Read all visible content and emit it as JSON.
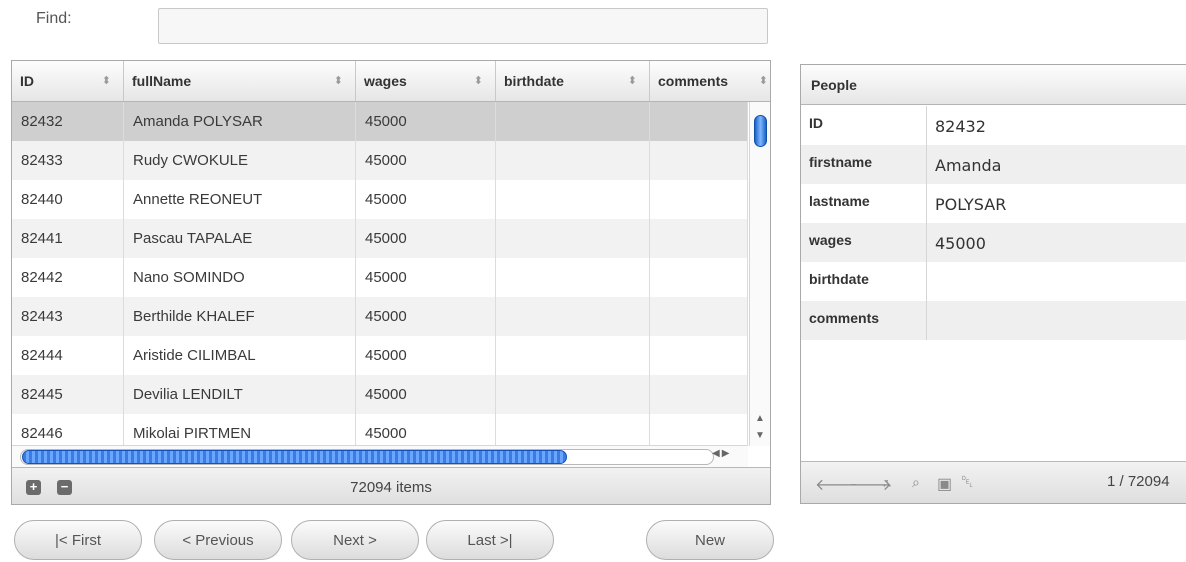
{
  "find": {
    "label": "Find:",
    "value": ""
  },
  "grid": {
    "columns": [
      "ID",
      "fullName",
      "wages",
      "birthdate",
      "comments"
    ],
    "rows": [
      [
        "82432",
        "Amanda POLYSAR",
        "45000",
        "",
        ""
      ],
      [
        "82433",
        "Rudy CWOKULE",
        "45000",
        "",
        ""
      ],
      [
        "82440",
        "Annette REONEUT",
        "45000",
        "",
        ""
      ],
      [
        "82441",
        "Pascau TAPALAE",
        "45000",
        "",
        ""
      ],
      [
        "82442",
        "Nano SOMINDO",
        "45000",
        "",
        ""
      ],
      [
        "82443",
        "Berthilde KHALEF",
        "45000",
        "",
        ""
      ],
      [
        "82444",
        "Aristide CILIMBAL",
        "45000",
        "",
        ""
      ],
      [
        "82445",
        "Devilia LENDILT",
        "45000",
        "",
        ""
      ],
      [
        "82446",
        "Mikolai PIRTMEN",
        "45000",
        "",
        ""
      ]
    ],
    "selected_row": 0,
    "sort_glyph": "⬍",
    "add_glyph": "+",
    "remove_glyph": "−",
    "item_count": "72094 items"
  },
  "nav": {
    "first": "|< First",
    "previous": "< Previous",
    "next": "Next >",
    "last": "Last >|",
    "new": "New"
  },
  "form": {
    "title": "People",
    "fields": [
      {
        "label": "ID",
        "value": "82432"
      },
      {
        "label": "firstname",
        "value": "Amanda"
      },
      {
        "label": "lastname",
        "value": "POLYSAR"
      },
      {
        "label": "wages",
        "value": "45000"
      },
      {
        "label": "birthdate",
        "value": ""
      },
      {
        "label": "comments",
        "value": ""
      }
    ],
    "toolbar_icons": [
      "arrow-left-icon",
      "arrow-right-icon",
      "tree-icon",
      "search-icon",
      "save-icon",
      "trash-icon"
    ],
    "pager": "1 / 72094"
  },
  "colors": {
    "accent": "#2f78dc",
    "selected_row": "#cfcfcf"
  }
}
